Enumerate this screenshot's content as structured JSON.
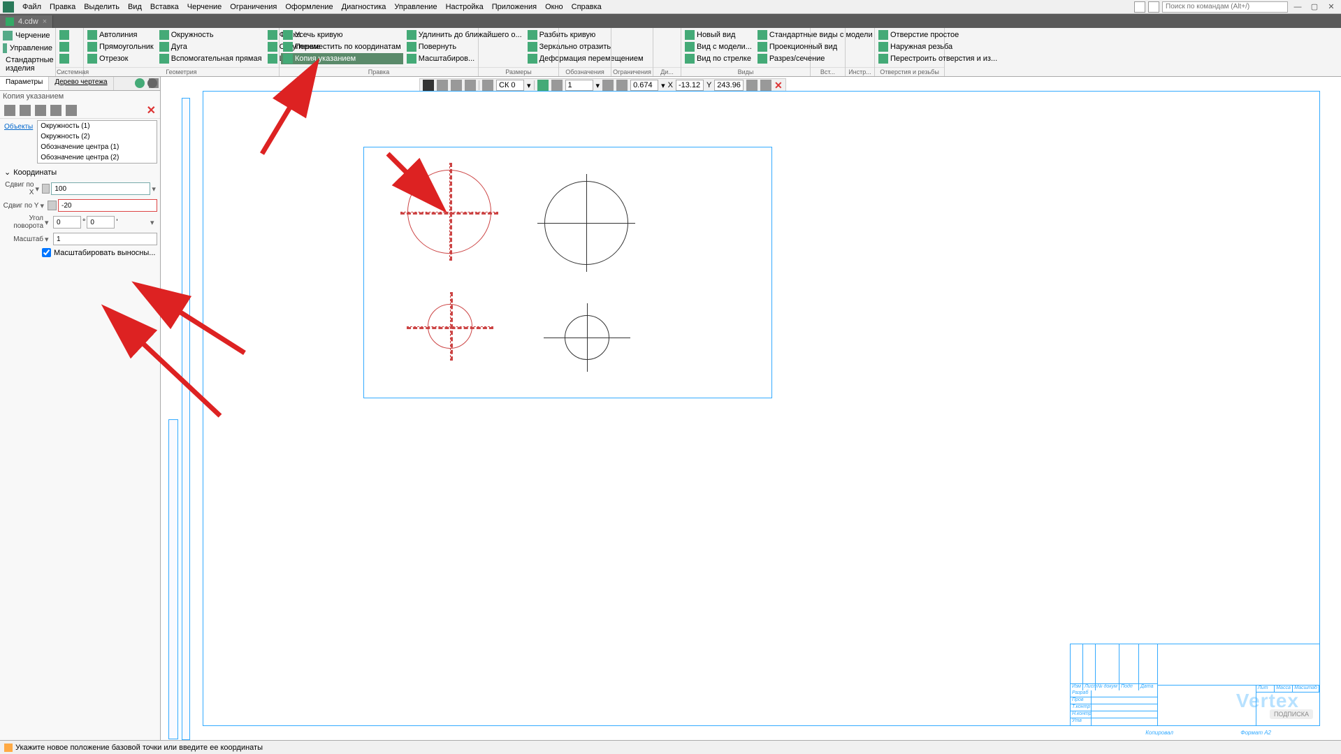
{
  "menu": [
    "Файл",
    "Правка",
    "Выделить",
    "Вид",
    "Вставка",
    "Черчение",
    "Ограничения",
    "Оформление",
    "Диагностика",
    "Управление",
    "Настройка",
    "Приложения",
    "Окно",
    "Справка"
  ],
  "search_placeholder": "Поиск по командам (Alt+/)",
  "tab": {
    "label": "4.cdw"
  },
  "ribbon_left": [
    "Черчение",
    "Управление",
    "Стандартные изделия"
  ],
  "ribbon_groups": {
    "sys": {
      "title": "Системная"
    },
    "geom": {
      "title": "Геометрия",
      "items": [
        [
          "Автолиния",
          "Окружность",
          "Фаска"
        ],
        [
          "Прямоугольник",
          "Дуга",
          "Скругление"
        ],
        [
          "Отрезок",
          "Вспомогательная прямая",
          "Штриховка"
        ]
      ]
    },
    "edit": {
      "title": "Правка",
      "items": [
        [
          "Усечь кривую",
          "Удлинить до ближайшего о...",
          "Разбить кривую"
        ],
        [
          "Переместить по координатам",
          "Повернуть",
          "Зеркально отразить"
        ],
        [
          "Копия указанием",
          "Масштабиров...",
          "Деформация перемещением"
        ]
      ]
    },
    "dims": {
      "title": "Размеры"
    },
    "mark": {
      "title": "Обозначения"
    },
    "constr": {
      "title": "Ограничения"
    },
    "diag": {
      "title": "Ди..."
    },
    "views": {
      "title": "Виды",
      "items": [
        "Новый вид",
        "Вид с модели...",
        "Вид по стрелке",
        "Стандартные виды с модели",
        "Проекционный вид",
        "Разрез/сечение"
      ]
    },
    "ins": {
      "title": "Вст..."
    },
    "instr": {
      "title": "Инстр..."
    },
    "holes": {
      "title": "Отверстия и резьбы",
      "items": [
        "Отверстие простое",
        "Наружная резьба",
        "Перестроить отверстия и из..."
      ]
    }
  },
  "side": {
    "tab1": "Параметры",
    "tab2": "Дерево чертежа",
    "sub": "Копия указанием",
    "objects_label": "Объекты",
    "objects": [
      "Окружность (1)",
      "Окружность (2)",
      "Обозначение центра (1)",
      "Обозначение центра (2)"
    ],
    "coords_header": "Координаты",
    "shift_x_label": "Сдвиг по X",
    "shift_x_val": "100",
    "shift_y_label": "Сдвиг по Y",
    "shift_y_val": "-20",
    "angle_label": "Угол поворота",
    "angle_deg": "0",
    "angle_min": "0",
    "scale_label": "Масштаб",
    "scale_val": "1",
    "scale_checkbox": "Масштабировать выносны..."
  },
  "canvas_toolbar": {
    "layer": "СК 0",
    "num": "1",
    "zoom": "0.674",
    "x_lbl": "X",
    "x_val": "-13.12",
    "y_lbl": "Y",
    "y_val": "243.96"
  },
  "title_block": {
    "cols": [
      "Изм",
      "Лист",
      "№ докум",
      "Подп",
      "Дата"
    ],
    "rows": [
      "Разраб",
      "Пров",
      "Т.контр",
      "Н.контр",
      "Утв"
    ],
    "right": [
      "Лит",
      "Масса",
      "Масштаб"
    ],
    "footer_l": "Копировал",
    "footer_r": "Формат   А2"
  },
  "watermark": "Vertex",
  "status": "Укажите новое положение базовой точки или введите ее координаты"
}
